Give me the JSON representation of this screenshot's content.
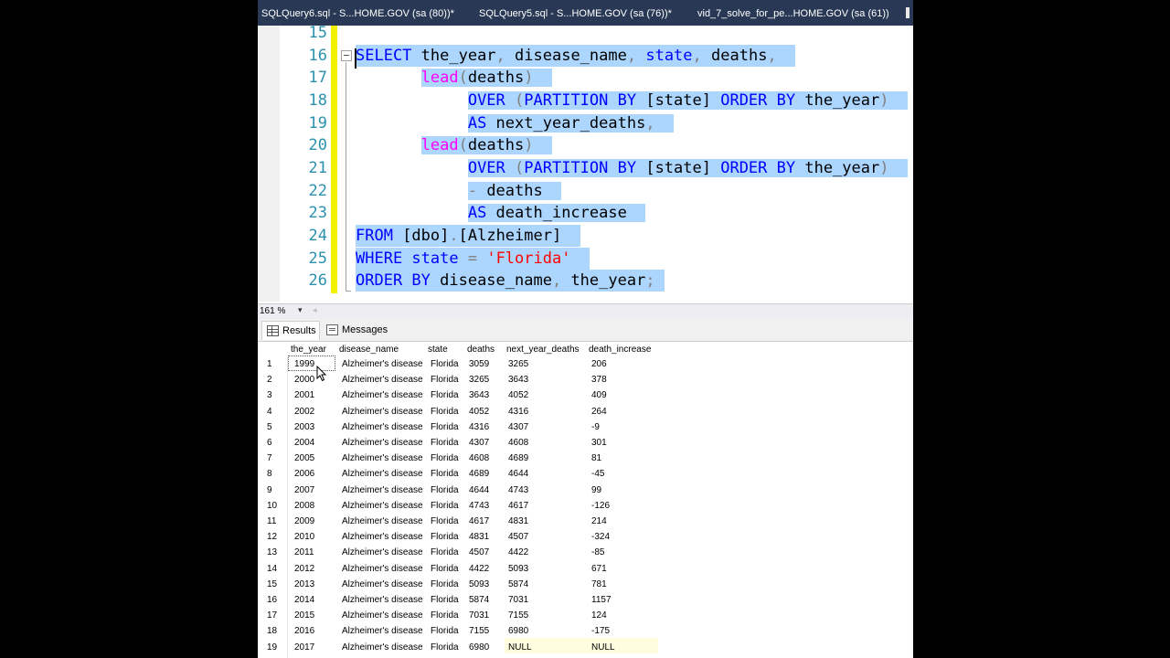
{
  "tabs": [
    {
      "label": "SQLQuery6.sql - S...HOME.GOV (sa (80))*"
    },
    {
      "label": "SQLQuery5.sql - S...HOME.GOV (sa (76))*"
    },
    {
      "label": "vid_7_solve_for_pe...HOME.GOV (sa (61))"
    }
  ],
  "editor": {
    "line_numbers": [
      "15",
      "16",
      "17",
      "18",
      "19",
      "20",
      "21",
      "22",
      "23",
      "24",
      "25",
      "26"
    ],
    "code": {
      "l16": {
        "a": "SELECT",
        "b": " the_year",
        "c": ",",
        "d": " disease_name",
        "e": ",",
        "f": " state",
        "g": ",",
        "h": " deaths",
        "i": ","
      },
      "l17": {
        "indent": "       ",
        "a": "lead",
        "b": "(",
        "c": "deaths",
        "d": ")"
      },
      "l18": {
        "indent": "            ",
        "a": "OVER",
        "b": " (",
        "c": "PARTITION BY",
        "d": " [state] ",
        "e": "ORDER BY",
        "f": " the_year",
        "g": ")"
      },
      "l19": {
        "indent": "            ",
        "a": "AS",
        "b": " next_year_deaths",
        "c": ","
      },
      "l20": {
        "indent": "       ",
        "a": "lead",
        "b": "(",
        "c": "deaths",
        "d": ")"
      },
      "l21": {
        "indent": "            ",
        "a": "OVER",
        "b": " (",
        "c": "PARTITION BY",
        "d": " [state] ",
        "e": "ORDER BY",
        "f": " the_year",
        "g": ")"
      },
      "l22": {
        "indent": "            ",
        "a": "-",
        "b": " deaths"
      },
      "l23": {
        "indent": "            ",
        "a": "AS",
        "b": " death_increase"
      },
      "l24": {
        "a": "FROM",
        "b": " [dbo]",
        "c": ".",
        "d": "[Alzheimer]"
      },
      "l25": {
        "a": "WHERE",
        "b": " state ",
        "c": "=",
        "d": " 'Florida'"
      },
      "l26": {
        "a": "ORDER BY",
        "b": " disease_name",
        "c": ",",
        "d": " the_year",
        "e": ";"
      }
    }
  },
  "zoom": {
    "value": "161 %",
    "arrow": "▾",
    "scroll": "◂"
  },
  "results_tabs": {
    "results": "Results",
    "messages": "Messages"
  },
  "grid": {
    "columns": [
      "the_year",
      "disease_name",
      "state",
      "deaths",
      "next_year_deaths",
      "death_increase"
    ],
    "rows": [
      [
        "1",
        "1999",
        "Alzheimer's disease",
        "Florida",
        "3059",
        "3265",
        "206"
      ],
      [
        "2",
        "2000",
        "Alzheimer's disease",
        "Florida",
        "3265",
        "3643",
        "378"
      ],
      [
        "3",
        "2001",
        "Alzheimer's disease",
        "Florida",
        "3643",
        "4052",
        "409"
      ],
      [
        "4",
        "2002",
        "Alzheimer's disease",
        "Florida",
        "4052",
        "4316",
        "264"
      ],
      [
        "5",
        "2003",
        "Alzheimer's disease",
        "Florida",
        "4316",
        "4307",
        "-9"
      ],
      [
        "6",
        "2004",
        "Alzheimer's disease",
        "Florida",
        "4307",
        "4608",
        "301"
      ],
      [
        "7",
        "2005",
        "Alzheimer's disease",
        "Florida",
        "4608",
        "4689",
        "81"
      ],
      [
        "8",
        "2006",
        "Alzheimer's disease",
        "Florida",
        "4689",
        "4644",
        "-45"
      ],
      [
        "9",
        "2007",
        "Alzheimer's disease",
        "Florida",
        "4644",
        "4743",
        "99"
      ],
      [
        "10",
        "2008",
        "Alzheimer's disease",
        "Florida",
        "4743",
        "4617",
        "-126"
      ],
      [
        "11",
        "2009",
        "Alzheimer's disease",
        "Florida",
        "4617",
        "4831",
        "214"
      ],
      [
        "12",
        "2010",
        "Alzheimer's disease",
        "Florida",
        "4831",
        "4507",
        "-324"
      ],
      [
        "13",
        "2011",
        "Alzheimer's disease",
        "Florida",
        "4507",
        "4422",
        "-85"
      ],
      [
        "14",
        "2012",
        "Alzheimer's disease",
        "Florida",
        "4422",
        "5093",
        "671"
      ],
      [
        "15",
        "2013",
        "Alzheimer's disease",
        "Florida",
        "5093",
        "5874",
        "781"
      ],
      [
        "16",
        "2014",
        "Alzheimer's disease",
        "Florida",
        "5874",
        "7031",
        "1157"
      ],
      [
        "17",
        "2015",
        "Alzheimer's disease",
        "Florida",
        "7031",
        "7155",
        "124"
      ],
      [
        "18",
        "2016",
        "Alzheimer's disease",
        "Florida",
        "7155",
        "6980",
        "-175"
      ],
      [
        "19",
        "2017",
        "Alzheimer's disease",
        "Florida",
        "6980",
        "NULL",
        "NULL"
      ]
    ]
  }
}
